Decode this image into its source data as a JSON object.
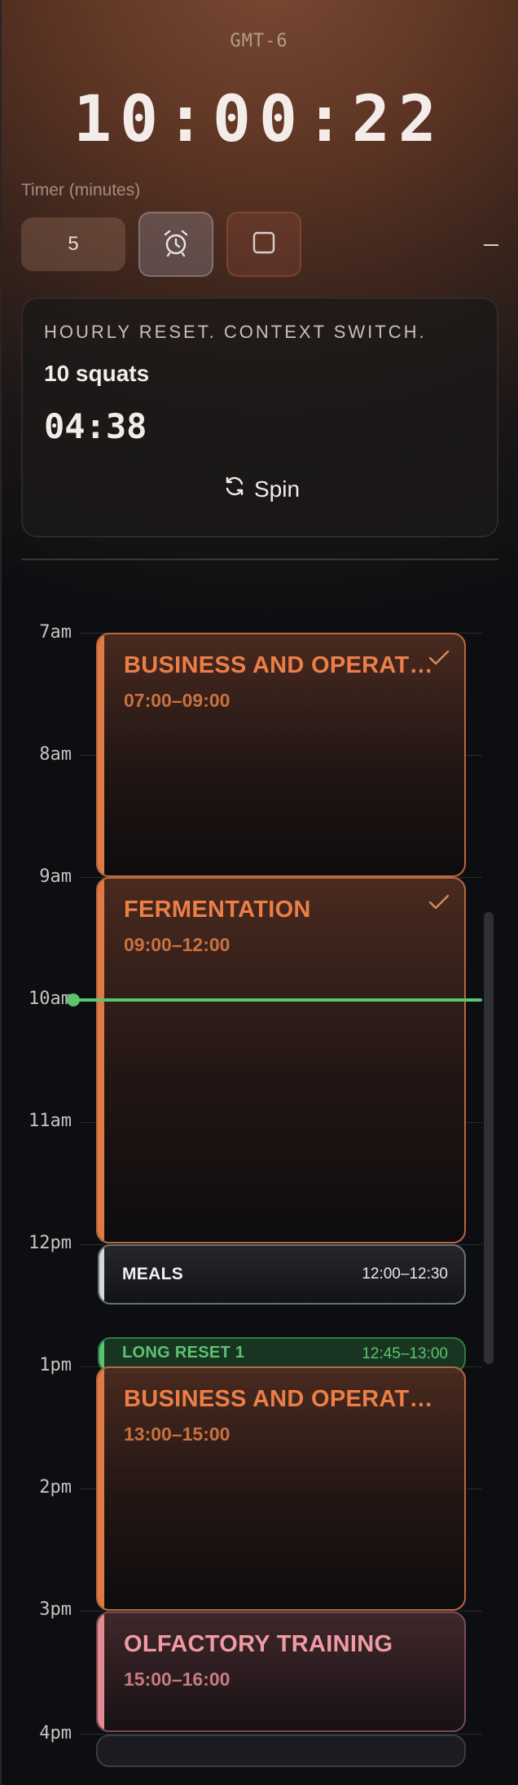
{
  "header": {
    "timezone": "GMT-6",
    "clock": "10:00:22",
    "timer_label": "Timer (minutes)",
    "timer_value": "5",
    "alarm_icon": "alarm-clock-icon",
    "stop_icon": "stop-square-icon",
    "minimize_icon": "minimize-icon"
  },
  "reset_card": {
    "title": "HOURLY RESET. CONTEXT SWITCH.",
    "task": "10 squats",
    "countdown": "04:38",
    "spin_label": "Spin",
    "spin_icon": "refresh-icon"
  },
  "timeline": {
    "hours": [
      "7am",
      "8am",
      "9am",
      "10am",
      "11am",
      "12pm",
      "1pm",
      "2pm",
      "3pm",
      "4pm"
    ],
    "now_color": "#5cc36f",
    "events": [
      {
        "title": "BUSINESS AND OPERATI...",
        "time": "07:00–09:00",
        "done": true,
        "color": "#e07a45"
      },
      {
        "title": "FERMENTATION",
        "time": "09:00–12:00",
        "done": true,
        "color": "#e07a45"
      },
      {
        "title": "MEALS",
        "time": "12:00–12:30",
        "color": "#d6d8dd"
      },
      {
        "title": "LONG RESET 1",
        "time": "12:45–13:00",
        "color": "#5cc36f"
      },
      {
        "title": "BUSINESS AND OPERATI...",
        "time": "13:00–15:00",
        "color": "#e07a45"
      },
      {
        "title": "OLFACTORY TRAINING",
        "time": "15:00–16:00",
        "color": "#e48a93"
      }
    ]
  }
}
